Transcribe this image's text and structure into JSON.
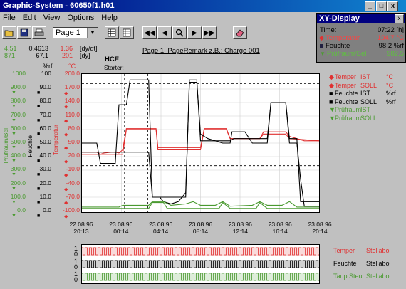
{
  "window": {
    "title": "Graphic-System - 60650f1.h01",
    "buttons": [
      "_",
      "□",
      "x"
    ]
  },
  "menu": [
    "File",
    "Edit",
    "View",
    "Options",
    "Help"
  ],
  "toolbar": {
    "page_select": "Page 1",
    "icons": [
      "open-folder",
      "save-disk",
      "print",
      "grid",
      "table",
      "rewind",
      "prev",
      "zoom",
      "next",
      "fast-forward",
      "eraser"
    ]
  },
  "header": {
    "col1": [
      "4.51",
      "871"
    ],
    "col2": [
      "0.4613",
      "67.1"
    ],
    "col3": [
      "1.36",
      "201"
    ],
    "units": [
      "[dy/dt]",
      "[dy]"
    ],
    "unit_rf": "%rf",
    "unit_c": "°C",
    "page_remark": "Page 1: PageRemark z.B.: Charge 001",
    "marker_title": "HCE",
    "marker_sub": "Starter:"
  },
  "xy_display": {
    "title": "XY-Display",
    "close": "x",
    "rows": [
      {
        "label": "Time:",
        "value": "07:22 [h]",
        "color": "#000000",
        "marker": ""
      },
      {
        "label": "Temperatur",
        "value": "194.7 °C",
        "color": "#e03030",
        "marker": "red-diamond"
      },
      {
        "label": "Feuchte",
        "value": "98.2 %rf",
        "color": "#000000",
        "marker": "dark-square"
      },
      {
        "label": "Prüfraum/Bel",
        "value": "982.5",
        "color": "#4a9a30",
        "marker": "green-triangle"
      }
    ]
  },
  "axes": {
    "left_green": [
      "1000",
      "900.0",
      "800.0",
      "700.0",
      "600.0",
      "500.0",
      "400.0",
      "300.0",
      "200.0",
      "100.0",
      "0.0"
    ],
    "left_black": [
      "100",
      "90.0",
      "80.0",
      "70.0",
      "60.0",
      "50.0",
      "40.0",
      "30.0",
      "20.0",
      "10.0",
      "0.0"
    ],
    "left_red": [
      "200.0",
      "170.0",
      "140.0",
      "110.0",
      "80.0",
      "50.0",
      "20.0",
      "-10.0",
      "-40.0",
      "-70.0",
      "-100.0"
    ],
    "label_green": "Prüfraum/Bel",
    "label_black": "Feuchte",
    "label_red": "Temperatur"
  },
  "legend": [
    {
      "name": "Temper",
      "state": "IST",
      "unit": "°C",
      "color": "#e03030",
      "marker": "◆"
    },
    {
      "name": "Temper",
      "state": "SOLL",
      "unit": "°C",
      "color": "#e03030",
      "marker": "◆"
    },
    {
      "name": "Feuchte",
      "state": "IST",
      "unit": "%rf",
      "color": "#000000",
      "marker": "■"
    },
    {
      "name": "Feuchte",
      "state": "SOLL",
      "unit": "%rf",
      "color": "#000000",
      "marker": "■"
    },
    {
      "name": "Prüfraum",
      "state": "IST",
      "unit": "",
      "color": "#4a9a30",
      "marker": "▼"
    },
    {
      "name": "Prüfraum",
      "state": "SOLL",
      "unit": "",
      "color": "#4a9a30",
      "marker": "▼"
    }
  ],
  "x_ticks": [
    {
      "date": "22.08.96",
      "time": "20:13"
    },
    {
      "date": "23.08.96",
      "time": "00:14"
    },
    {
      "date": "23.08.96",
      "time": "04:14"
    },
    {
      "date": "23.08.96",
      "time": "08:14"
    },
    {
      "date": "23.08.96",
      "time": "12:14"
    },
    {
      "date": "23.08.96",
      "time": "16:14"
    },
    {
      "date": "23.08.96",
      "time": "20:14"
    }
  ],
  "digital": [
    {
      "name": "Temper",
      "channel": "Stellabo",
      "color": "#e03030",
      "hi": "1",
      "lo": "0"
    },
    {
      "name": "Feuchte",
      "channel": "Stellabo",
      "color": "#000000",
      "hi": "1",
      "lo": "0"
    },
    {
      "name": "Taup.Steu",
      "channel": "Stellabo",
      "color": "#4a9a30",
      "hi": "1",
      "lo": "0"
    }
  ],
  "chart_data": {
    "type": "line",
    "x_hours": [
      0,
      4,
      8,
      12,
      16,
      20,
      24
    ],
    "ylim_temp": [
      -100,
      200
    ],
    "series": [
      {
        "name": "Temper IST",
        "color": "#e03030",
        "points": [
          [
            0,
            30
          ],
          [
            4,
            30
          ],
          [
            5,
            25
          ],
          [
            6,
            28
          ],
          [
            8,
            30
          ],
          [
            9,
            30
          ],
          [
            10,
            28
          ],
          [
            11,
            35
          ],
          [
            12,
            82
          ],
          [
            20,
            82
          ],
          [
            20.5,
            40
          ],
          [
            22,
            40
          ],
          [
            24,
            40
          ],
          [
            28,
            40
          ],
          [
            32,
            40
          ],
          [
            33,
            82
          ],
          [
            39,
            82
          ],
          [
            40,
            60
          ],
          [
            44,
            60
          ],
          [
            48,
            60
          ],
          [
            49,
            75
          ],
          [
            55,
            75
          ],
          [
            56,
            65
          ],
          [
            60,
            55
          ],
          [
            64,
            55
          ]
        ]
      },
      {
        "name": "Temper SOLL",
        "color": "#e03030",
        "points": [
          [
            0,
            25
          ],
          [
            11,
            25
          ],
          [
            12,
            80
          ],
          [
            20,
            80
          ],
          [
            20.5,
            35
          ],
          [
            32,
            35
          ],
          [
            33,
            80
          ],
          [
            39,
            80
          ],
          [
            40,
            60
          ],
          [
            48,
            60
          ],
          [
            49,
            70
          ],
          [
            55,
            70
          ],
          [
            56,
            60
          ],
          [
            64,
            55
          ]
        ]
      },
      {
        "name": "Feuchte IST",
        "color": "#000000",
        "points": [
          [
            0,
            50
          ],
          [
            4,
            50
          ],
          [
            5,
            5
          ],
          [
            8,
            5
          ],
          [
            9,
            5
          ],
          [
            10,
            135
          ],
          [
            12,
            135
          ],
          [
            13,
            190
          ],
          [
            16,
            190
          ],
          [
            18,
            190
          ],
          [
            19,
            -70
          ],
          [
            21,
            -70
          ],
          [
            22,
            -80
          ],
          [
            24,
            -85
          ],
          [
            26,
            -80
          ],
          [
            28,
            -60
          ],
          [
            29,
            185
          ],
          [
            31,
            185
          ],
          [
            32,
            70
          ],
          [
            34,
            60
          ],
          [
            36,
            55
          ],
          [
            38,
            50
          ],
          [
            40,
            50
          ],
          [
            40.5,
            75
          ],
          [
            44,
            75
          ],
          [
            46,
            50
          ],
          [
            50,
            50
          ],
          [
            51,
            140
          ],
          [
            55,
            140
          ],
          [
            56,
            50
          ],
          [
            58,
            50
          ],
          [
            59,
            -30
          ],
          [
            60,
            -90
          ],
          [
            64,
            -90
          ]
        ]
      },
      {
        "name": "Feuchte SOLL",
        "color": "#000000",
        "points": [
          [
            0,
            30
          ],
          [
            11,
            30
          ],
          [
            12,
            30
          ],
          [
            13,
            30
          ],
          [
            18,
            30
          ],
          [
            19,
            -70
          ],
          [
            28,
            -70
          ],
          [
            29,
            190
          ],
          [
            31,
            190
          ],
          [
            32,
            55
          ],
          [
            40,
            55
          ],
          [
            41,
            60
          ],
          [
            50,
            60
          ],
          [
            51,
            140
          ],
          [
            55,
            140
          ],
          [
            56,
            60
          ],
          [
            58,
            60
          ],
          [
            59,
            -80
          ],
          [
            64,
            -80
          ]
        ]
      },
      {
        "name": "Prüfraum IST",
        "color": "#4a9a30",
        "points": [
          [
            0,
            -92
          ],
          [
            10,
            -92
          ],
          [
            11,
            -88
          ],
          [
            18,
            -88
          ],
          [
            19,
            -80
          ],
          [
            22,
            -80
          ],
          [
            24,
            -88
          ],
          [
            28,
            -85
          ],
          [
            30,
            -80
          ],
          [
            32,
            -88
          ],
          [
            36,
            -88
          ],
          [
            38,
            -80
          ],
          [
            40,
            -90
          ],
          [
            46,
            -88
          ],
          [
            48,
            -80
          ],
          [
            50,
            -88
          ],
          [
            54,
            -88
          ],
          [
            56,
            -80
          ],
          [
            58,
            -92
          ],
          [
            64,
            -92
          ]
        ]
      },
      {
        "name": "Prüfraum SOLL",
        "color": "#4a9a30",
        "points": [
          [
            0,
            -95
          ],
          [
            18,
            -95
          ],
          [
            19,
            -82
          ],
          [
            22,
            -82
          ],
          [
            23,
            -95
          ],
          [
            37,
            -95
          ],
          [
            38,
            -82
          ],
          [
            40,
            -95
          ],
          [
            47,
            -95
          ],
          [
            48,
            -82
          ],
          [
            50,
            -95
          ],
          [
            64,
            -95
          ]
        ]
      }
    ]
  }
}
